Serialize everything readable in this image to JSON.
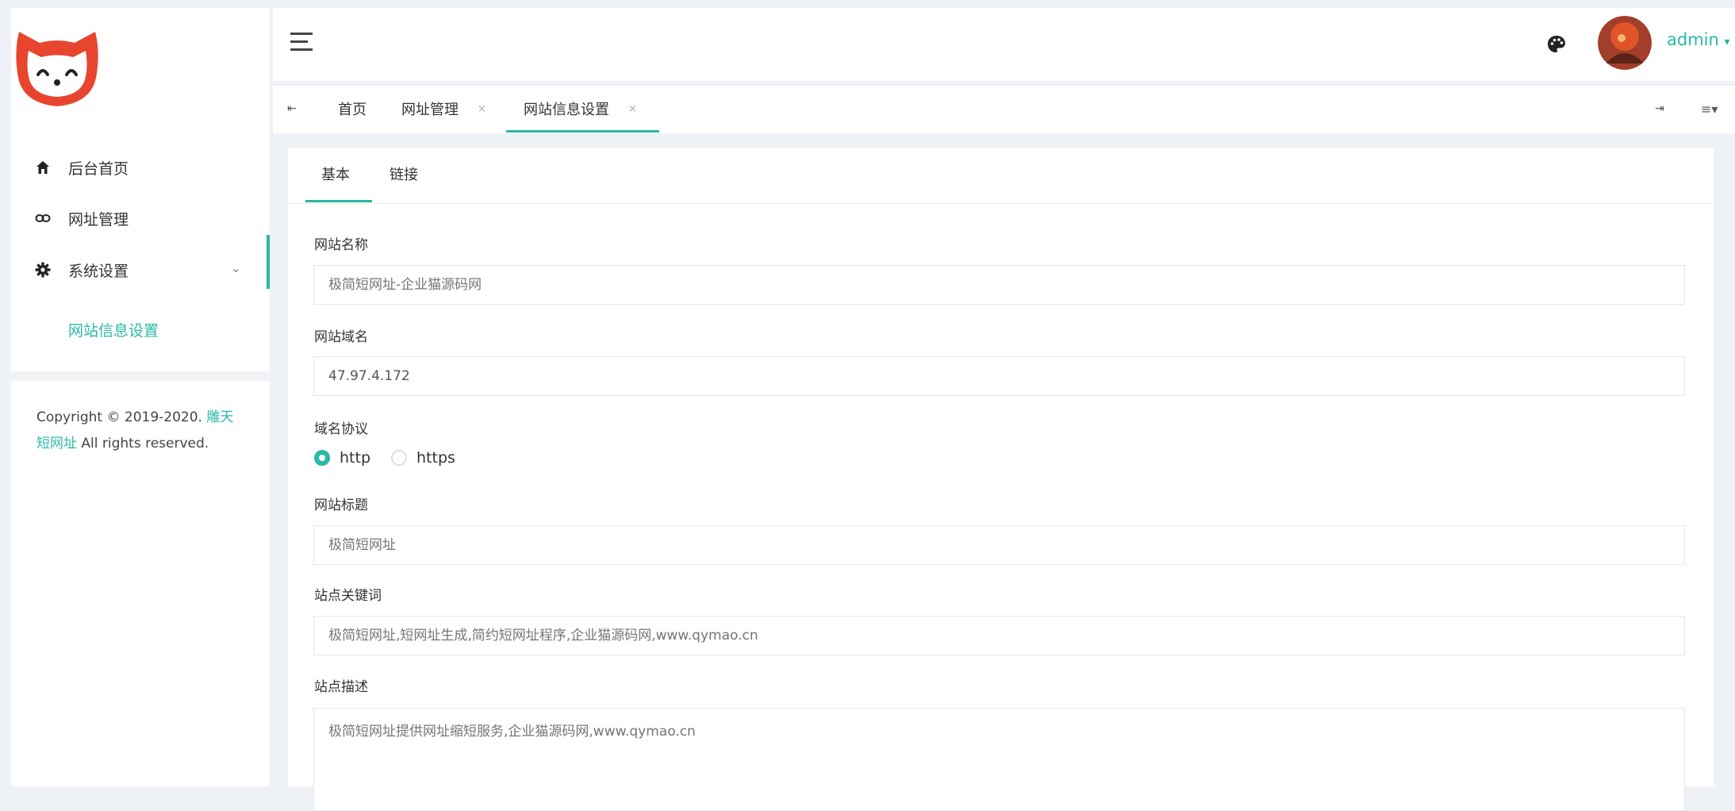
{
  "sidebar": {
    "menu": [
      {
        "label": "后台首页",
        "icon": "home-icon"
      },
      {
        "label": "网址管理",
        "icon": "link-icon"
      },
      {
        "label": "系统设置",
        "icon": "gear-icon"
      }
    ],
    "submenu": [
      {
        "label": "网站信息设置"
      }
    ],
    "copyright": {
      "prefix": "Copyright © 2019-2020.",
      "link_part1": "雕天",
      "link_part2": "短网址",
      "suffix": "All rights reserved."
    }
  },
  "header": {
    "user_name": "admin",
    "user_caret": "▾",
    "theme_icon": "palette-icon"
  },
  "tabs": {
    "items": [
      {
        "label": "首页",
        "closable": false
      },
      {
        "label": "网址管理",
        "closable": true
      },
      {
        "label": "网站信息设置",
        "closable": true,
        "active": true
      }
    ],
    "close_glyph": "×",
    "left_glyph": "⇤",
    "right_glyph": "⇥",
    "menu_glyph": "≡▾"
  },
  "form": {
    "tabs": [
      {
        "label": "基本"
      },
      {
        "label": "链接"
      }
    ],
    "fields": {
      "site_name": {
        "label": "网站名称",
        "placeholder": "极简短网址-企业猫源码网"
      },
      "domain": {
        "label": "网站域名",
        "value": "47.97.4.172"
      },
      "protocol": {
        "label": "域名协议",
        "options": [
          "http",
          "https"
        ],
        "selected": "http"
      },
      "title": {
        "label": "网站标题",
        "placeholder": "极简短网址"
      },
      "keywords": {
        "label": "站点关键词",
        "placeholder": "极简短网址,短网址生成,简约短网址程序,企业猫源码网,www.qymao.cn"
      },
      "description": {
        "label": "站点描述",
        "placeholder": "极简短网址提供网址缩短服务,企业猫源码网,www.qymao.cn"
      }
    }
  },
  "colors": {
    "accent": "#2bb8a6",
    "logo": "#e8452e"
  }
}
